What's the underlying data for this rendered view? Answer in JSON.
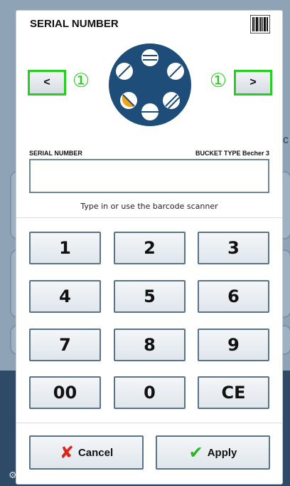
{
  "dialog": {
    "title": "SERIAL NUMBER",
    "barcode_icon": "barcode-icon",
    "prev_label": "<",
    "next_label": ">",
    "marker_left": "①",
    "marker_right": "①",
    "serial_label": "SERIAL NUMBER",
    "bucket_label": "BUCKET TYPE Becher 3",
    "serial_value": "",
    "hint": "Type in or use the barcode scanner",
    "keys": [
      "1",
      "2",
      "3",
      "4",
      "5",
      "6",
      "7",
      "8",
      "9",
      "00",
      "0",
      "CE"
    ],
    "cancel_label": "Cancel",
    "apply_label": "Apply",
    "cancel_icon": "x-icon",
    "apply_icon": "check-icon"
  },
  "background": {
    "partial_letter": "c",
    "settings_icon": "gear-icon",
    "help_label": "?"
  },
  "colors": {
    "highlight": "#27d020",
    "rotor_fill": "#1f4d7a",
    "active_bucket": "#f3a31a",
    "cancel_icon": "#e0241b",
    "apply_icon": "#2db624"
  }
}
